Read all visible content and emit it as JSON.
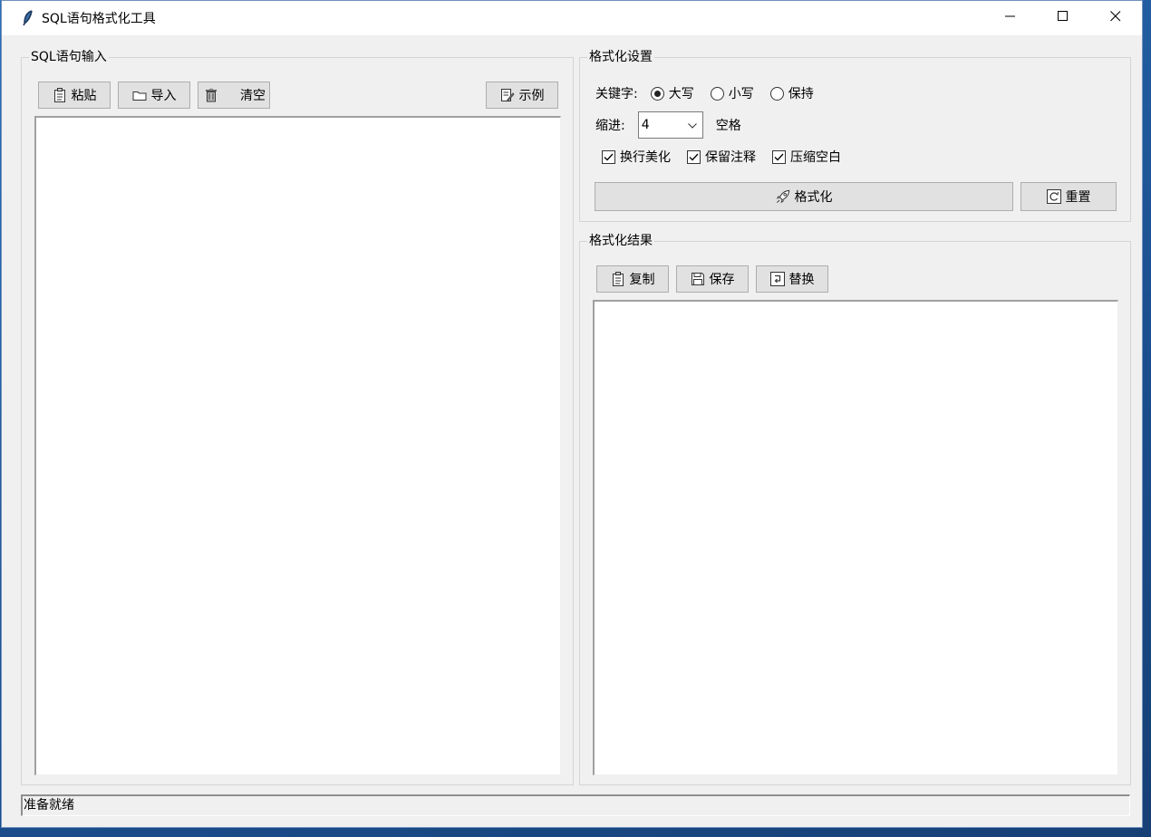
{
  "window": {
    "title": "SQL语句格式化工具",
    "title_icon": "feather-icon",
    "controls": [
      "minimize-icon",
      "maximize-icon",
      "close-icon"
    ]
  },
  "input_panel": {
    "title": "SQL语句输入",
    "toolbar": {
      "paste_label": "粘贴",
      "import_label": "导入",
      "clear_label": "清空",
      "example_label": "示例"
    },
    "text": ""
  },
  "settings_panel": {
    "title": "格式化设置",
    "keyword_label": "关键字:",
    "keyword_options": [
      {
        "label": "大写",
        "selected": true
      },
      {
        "label": "小写",
        "selected": false
      },
      {
        "label": "保持",
        "selected": false
      }
    ],
    "indent_label": "缩进:",
    "indent_value": "4",
    "indent_unit": "空格",
    "options": [
      {
        "label": "换行美化",
        "checked": true
      },
      {
        "label": "保留注释",
        "checked": true
      },
      {
        "label": "压缩空白",
        "checked": true
      }
    ],
    "format_button": "格式化",
    "reset_button": "重置"
  },
  "result_panel": {
    "title": "格式化结果",
    "toolbar": {
      "copy_label": "复制",
      "save_label": "保存",
      "replace_label": "替换"
    },
    "text": ""
  },
  "status": "准备就绪",
  "colors": {
    "window_bg": "#f0f0f0",
    "button_bg": "#e1e1e1",
    "button_border": "#adadad",
    "desktop": "#1b4f8f"
  }
}
